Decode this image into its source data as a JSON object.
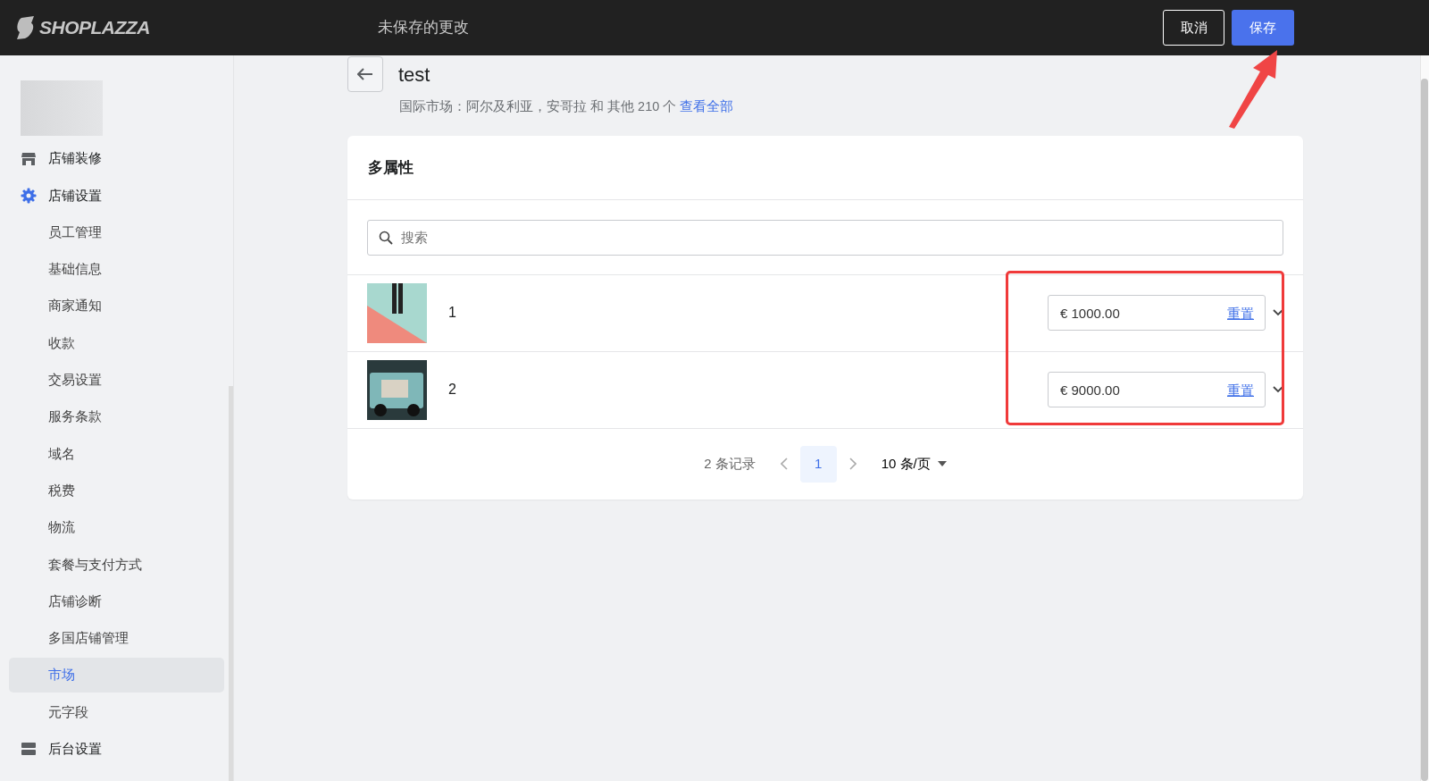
{
  "header": {
    "logo": "SHOPLAZZA",
    "title": "未保存的更改",
    "buttons": [
      {
        "label": "取消",
        "kind": "outline"
      },
      {
        "label": "保存",
        "kind": "primary"
      }
    ]
  },
  "sidebar": {
    "items": [
      {
        "label": "店铺装修",
        "kind": "group",
        "selected": false
      },
      {
        "label": "店铺设置",
        "kind": "group",
        "selected": false
      },
      {
        "label": "员工管理",
        "kind": "sub",
        "selected": false
      },
      {
        "label": "基础信息",
        "kind": "sub",
        "selected": false
      },
      {
        "label": "商家通知",
        "kind": "sub",
        "selected": false
      },
      {
        "label": "收款",
        "kind": "sub",
        "selected": false
      },
      {
        "label": "交易设置",
        "kind": "sub",
        "selected": false
      },
      {
        "label": "服务条款",
        "kind": "sub",
        "selected": false
      },
      {
        "label": "域名",
        "kind": "sub",
        "selected": false
      },
      {
        "label": "税费",
        "kind": "sub",
        "selected": false
      },
      {
        "label": "物流",
        "kind": "sub",
        "selected": false
      },
      {
        "label": "套餐与支付方式",
        "kind": "sub",
        "selected": false
      },
      {
        "label": "店铺诊断",
        "kind": "sub",
        "selected": false
      },
      {
        "label": "多国店铺管理",
        "kind": "sub",
        "selected": false
      },
      {
        "label": "市场",
        "kind": "sub",
        "selected": true
      },
      {
        "label": "元字段",
        "kind": "sub",
        "selected": false
      },
      {
        "label": "后台设置",
        "kind": "group",
        "selected": false
      }
    ]
  },
  "page": {
    "title": "test",
    "subtitle": "国际市场：阿尔及利亚，安哥拉 和 其他 210 个",
    "subtitle_link": "查看全部"
  },
  "card": {
    "title": "多属性",
    "search": {
      "placeholder": "搜索"
    },
    "rows": [
      {
        "name": "1",
        "price": "€ 1000.00",
        "reset": "重置"
      },
      {
        "name": "2",
        "price": "€ 9000.00",
        "reset": "重置"
      }
    ],
    "pagination": {
      "total": "2 条记录",
      "pages": [
        {
          "label": "1",
          "selected": true
        }
      ],
      "page_size": "10 条/页"
    }
  }
}
